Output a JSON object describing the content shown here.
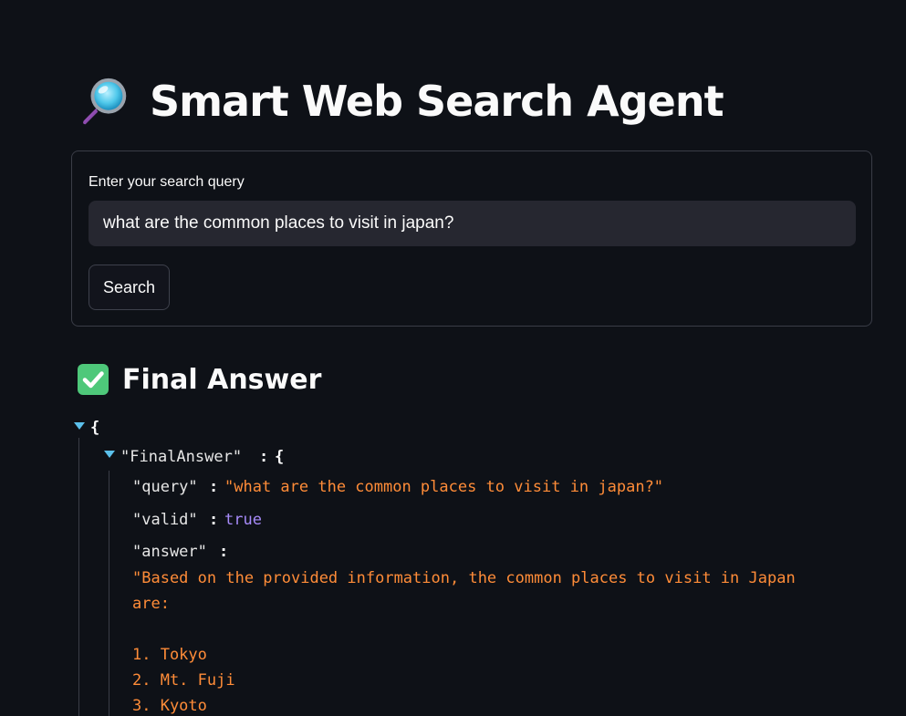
{
  "title": {
    "icon": "magnifying-glass-icon",
    "text": "Smart Web Search Agent"
  },
  "search_form": {
    "label": "Enter your search query",
    "input_value": "what are the common places to visit in japan?",
    "button_label": "Search"
  },
  "final_answer_section": {
    "icon": "check-mark-button-icon",
    "heading": "Final Answer"
  },
  "json_viewer": {
    "open_brace": "{",
    "root_key": "\"FinalAnswer\"",
    "colon": ":",
    "fields": {
      "query_key": "\"query\"",
      "query_value": "\"what are the common places to visit in japan?\"",
      "valid_key": "\"valid\"",
      "valid_value": "true",
      "answer_key": "\"answer\"",
      "answer_value": "\"Based on the provided information, the common places to visit in Japan are:\n\n1. Tokyo\n2. Mt. Fuji\n3. Kyoto"
    }
  },
  "colors": {
    "background": "#0e1117",
    "string": "#ff8c38",
    "boolean": "#a78bfa",
    "caret": "#5bc0eb",
    "input_bg": "#262730"
  }
}
